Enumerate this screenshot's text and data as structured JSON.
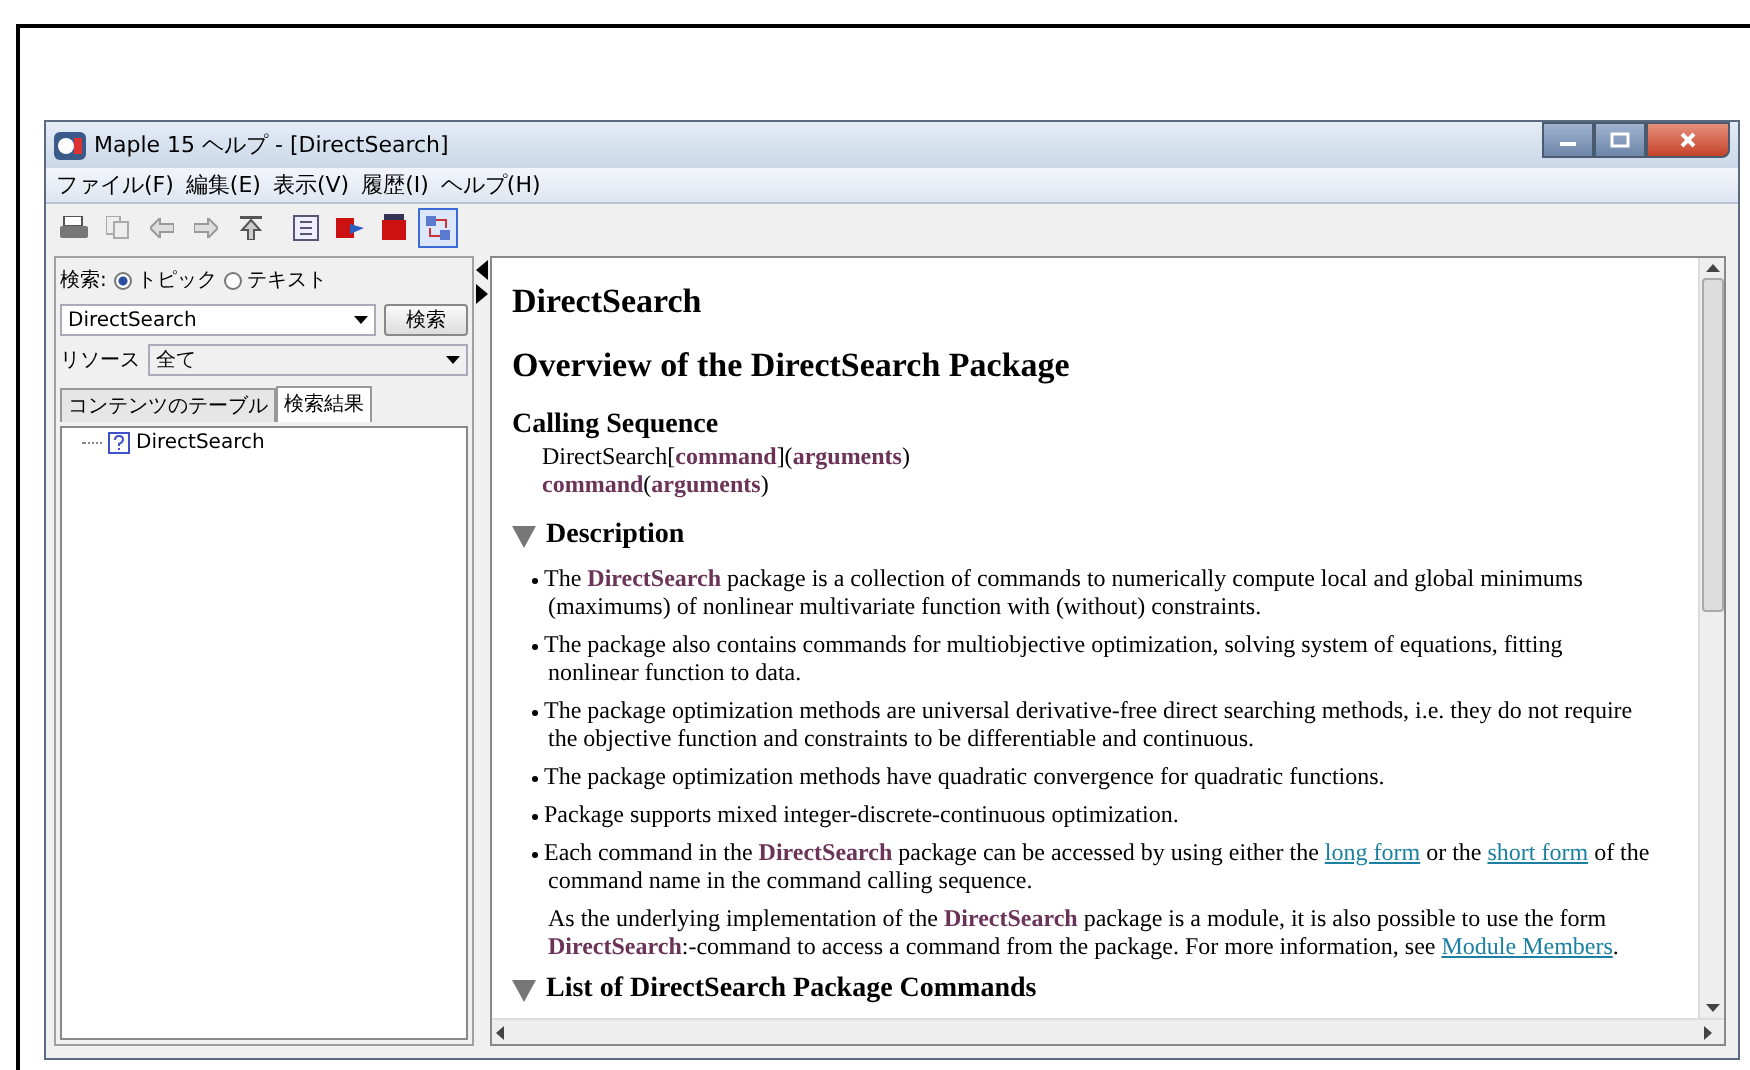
{
  "window": {
    "title": "Maple 15 ヘルプ - [DirectSearch]"
  },
  "menu": [
    {
      "label": "ファイル(F)"
    },
    {
      "label": "編集(E)"
    },
    {
      "label": "表示(V)"
    },
    {
      "label": "履歴(I)"
    },
    {
      "label": "ヘルプ(H)"
    }
  ],
  "sidebar": {
    "search_label": "検索:",
    "search_modes": [
      {
        "label": "トピック",
        "selected": true
      },
      {
        "label": "テキスト",
        "selected": false
      }
    ],
    "query": "DirectSearch",
    "search_button": "検索",
    "resource_label": "リソース",
    "resource_value": "全て",
    "tabs": [
      {
        "label": "コンテンツのテーブル",
        "selected": false
      },
      {
        "label": "検索結果",
        "selected": true
      }
    ],
    "results": [
      {
        "label": "DirectSearch"
      }
    ]
  },
  "content": {
    "title": "DirectSearch",
    "subtitle": "Overview of the DirectSearch Package",
    "calling_sequence": {
      "heading": "Calling Sequence",
      "lines": [
        "DirectSearch[**command**](**arguments**)",
        "**command**(**arguments**)"
      ]
    },
    "sections": [
      {
        "heading": "Description",
        "expanded": true,
        "items": [
          {
            "kind": "bullet",
            "segments": [
              {
                "text": "The **DirectSearch** package is a collection of commands to numerically compute local and global minimums (maximums) of nonlinear multivariate function with (without) constraints."
              }
            ]
          },
          {
            "kind": "bullet",
            "segments": [
              {
                "text": "The package also contains commands for multiobjective optimization, solving system of equations, fitting nonlinear function to data."
              }
            ]
          },
          {
            "kind": "bullet",
            "segments": [
              {
                "text": "The package optimization methods are universal derivative-free direct searching methods, i.e. they do not require the objective function and constraints to be differentiable and continuous."
              }
            ]
          },
          {
            "kind": "bullet",
            "segments": [
              {
                "text": "The package optimization methods have quadratic convergence for quadratic functions."
              }
            ]
          },
          {
            "kind": "bullet",
            "segments": [
              {
                "text": "Package supports mixed integer-discrete-continuous optimization."
              }
            ]
          },
          {
            "kind": "bullet",
            "segments": [
              {
                "text": "Each command in the **DirectSearch** package can be accessed by using either the "
              },
              {
                "link": "long form"
              },
              {
                "text": " or the "
              },
              {
                "link": "short form"
              },
              {
                "text": " of the command name in the command calling sequence."
              }
            ]
          },
          {
            "kind": "note",
            "segments": [
              {
                "text": "As the underlying implementation of the **DirectSearch** package is a module, it is also possible to use the form **DirectSearch**:-command to access a command from the package. For more information, see "
              },
              {
                "link": "Module Members"
              },
              {
                "text": "."
              }
            ]
          }
        ]
      },
      {
        "heading": "List of DirectSearch Package Commands",
        "expanded": true
      }
    ]
  }
}
